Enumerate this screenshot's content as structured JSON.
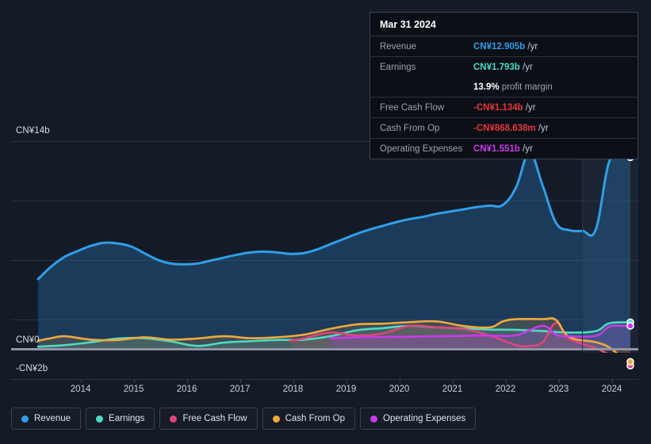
{
  "tooltip": {
    "title": "Mar 31 2024",
    "rows": [
      {
        "label": "Revenue",
        "value": "CN¥12.905b",
        "unit": "/yr",
        "color": "#2f9fe8"
      },
      {
        "label": "Earnings",
        "value": "CN¥1.793b",
        "unit": "/yr",
        "color": "#4fd9c4"
      },
      {
        "label": "",
        "value": "13.9%",
        "unit": "profit margin",
        "color": "#ffffff",
        "margin_row": true
      },
      {
        "label": "Free Cash Flow",
        "value": "-CN¥1.134b",
        "unit": "/yr",
        "color": "#e8353a"
      },
      {
        "label": "Cash From Op",
        "value": "-CN¥868.638m",
        "unit": "/yr",
        "color": "#e8353a"
      },
      {
        "label": "Operating Expenses",
        "value": "CN¥1.551b",
        "unit": "/yr",
        "color": "#c93ae8"
      }
    ]
  },
  "legend": {
    "items": [
      {
        "label": "Revenue",
        "color": "#2f9fe8"
      },
      {
        "label": "Earnings",
        "color": "#4fd9c4"
      },
      {
        "label": "Free Cash Flow",
        "color": "#e0457b"
      },
      {
        "label": "Cash From Op",
        "color": "#f0a93c"
      },
      {
        "label": "Operating Expenses",
        "color": "#c93ae8"
      }
    ]
  },
  "chart_data": {
    "type": "area",
    "title": "",
    "xlabel": "",
    "ylabel": "",
    "currency": "CN¥",
    "grid": true,
    "legend_position": "bottom",
    "y_axis": {
      "labels": [
        "CN¥14b",
        "CN¥0",
        "-CN¥2b"
      ],
      "tick_values": [
        14,
        0,
        -2
      ],
      "ylim": [
        -2,
        14
      ],
      "gridline_values": [
        14,
        10,
        6,
        2,
        0
      ],
      "zero_line": 0
    },
    "x_axis": {
      "tick_labels": [
        "2014",
        "2015",
        "2016",
        "2017",
        "2018",
        "2019",
        "2020",
        "2021",
        "2022",
        "2023",
        "2024"
      ],
      "xlim": [
        "2013.3",
        "2024.6"
      ]
    },
    "highlight_region": {
      "from": "2023.0",
      "to": "2024.6",
      "note": "selected period shading"
    },
    "series": [
      {
        "name": "Revenue",
        "color": "#2f9fe8",
        "fill": "rgba(40,110,170,0.40)",
        "x": [
          2013.3,
          2013.55,
          2013.8,
          2014.05,
          2014.3,
          2014.55,
          2014.8,
          2015.05,
          2015.3,
          2015.55,
          2015.8,
          2016.05,
          2016.3,
          2016.55,
          2016.8,
          2017.05,
          2017.3,
          2017.55,
          2017.8,
          2018.05,
          2018.3,
          2018.55,
          2018.8,
          2019.05,
          2019.3,
          2019.55,
          2019.8,
          2020.05,
          2020.3,
          2020.55,
          2020.8,
          2021.05,
          2021.3,
          2021.55,
          2021.8,
          2022.05,
          2022.3,
          2022.55,
          2022.8,
          2023.05,
          2023.3,
          2023.55,
          2023.8,
          2024.05,
          2024.3,
          2024.45
        ],
        "values": [
          4.7,
          5.55,
          6.2,
          6.6,
          6.95,
          7.15,
          7.1,
          6.9,
          6.45,
          6.0,
          5.75,
          5.7,
          5.75,
          5.95,
          6.15,
          6.35,
          6.5,
          6.55,
          6.5,
          6.4,
          6.45,
          6.7,
          7.05,
          7.4,
          7.75,
          8.05,
          8.3,
          8.55,
          8.75,
          8.9,
          9.1,
          9.25,
          9.4,
          9.55,
          9.65,
          9.7,
          10.9,
          13.2,
          11.0,
          8.5,
          8.0,
          7.95,
          8.05,
          12.6,
          13.1,
          12.905
        ]
      },
      {
        "name": "Earnings",
        "color": "#4fd9c4",
        "fill": "rgba(79,217,196,0.16)",
        "x": [
          2013.3,
          2013.8,
          2014.3,
          2014.8,
          2015.3,
          2015.8,
          2016.3,
          2016.8,
          2017.3,
          2017.8,
          2018.3,
          2018.8,
          2019.3,
          2019.8,
          2020.3,
          2020.8,
          2021.3,
          2021.8,
          2022.3,
          2022.8,
          2023.3,
          2023.8,
          2024.05,
          2024.45
        ],
        "values": [
          0.15,
          0.25,
          0.45,
          0.7,
          0.72,
          0.5,
          0.2,
          0.42,
          0.52,
          0.6,
          0.62,
          0.85,
          1.25,
          1.4,
          1.55,
          1.45,
          1.38,
          1.3,
          1.28,
          1.2,
          1.1,
          1.2,
          1.72,
          1.793
        ]
      },
      {
        "name": "Free Cash Flow",
        "color": "#e0457b",
        "fill": "rgba(224,69,123,0.16)",
        "x": [
          2018.05,
          2018.3,
          2018.8,
          2019.3,
          2019.8,
          2020.3,
          2020.8,
          2021.3,
          2021.8,
          2022.3,
          2022.55,
          2022.8,
          2023.05,
          2023.3,
          2023.8,
          2024.05,
          2024.3,
          2024.45
        ],
        "values": [
          0.55,
          0.7,
          1.1,
          0.9,
          1.05,
          1.55,
          1.45,
          1.35,
          0.9,
          0.25,
          0.2,
          0.45,
          1.75,
          0.7,
          0.05,
          -0.4,
          -0.95,
          -1.134
        ]
      },
      {
        "name": "Cash From Op",
        "color": "#f0a93c",
        "fill": "rgba(240,169,60,0.17)",
        "x": [
          2013.3,
          2013.55,
          2013.8,
          2014.3,
          2014.8,
          2015.3,
          2015.8,
          2016.3,
          2016.8,
          2017.3,
          2017.8,
          2018.3,
          2018.8,
          2019.3,
          2019.8,
          2020.3,
          2020.8,
          2021.3,
          2021.8,
          2022.05,
          2022.3,
          2022.8,
          2023.05,
          2023.3,
          2023.8,
          2024.05,
          2024.3,
          2024.45
        ],
        "values": [
          0.55,
          0.72,
          0.85,
          0.62,
          0.6,
          0.78,
          0.62,
          0.7,
          0.85,
          0.72,
          0.78,
          0.95,
          1.35,
          1.65,
          1.7,
          1.8,
          1.85,
          1.55,
          1.45,
          1.85,
          2.0,
          2.0,
          1.95,
          0.8,
          0.45,
          0.1,
          -0.6,
          -0.868
        ]
      },
      {
        "name": "Operating Expenses",
        "color": "#c93ae8",
        "fill": "rgba(150,70,200,0.30)",
        "x": [
          2018.8,
          2019.3,
          2019.8,
          2020.3,
          2020.8,
          2021.3,
          2021.8,
          2022.3,
          2022.8,
          2023.05,
          2023.3,
          2023.8,
          2024.05,
          2024.3,
          2024.45
        ],
        "values": [
          0.72,
          0.78,
          0.8,
          0.82,
          0.85,
          0.88,
          0.9,
          0.92,
          1.55,
          0.95,
          0.85,
          0.88,
          1.5,
          1.55,
          1.551
        ]
      }
    ]
  }
}
